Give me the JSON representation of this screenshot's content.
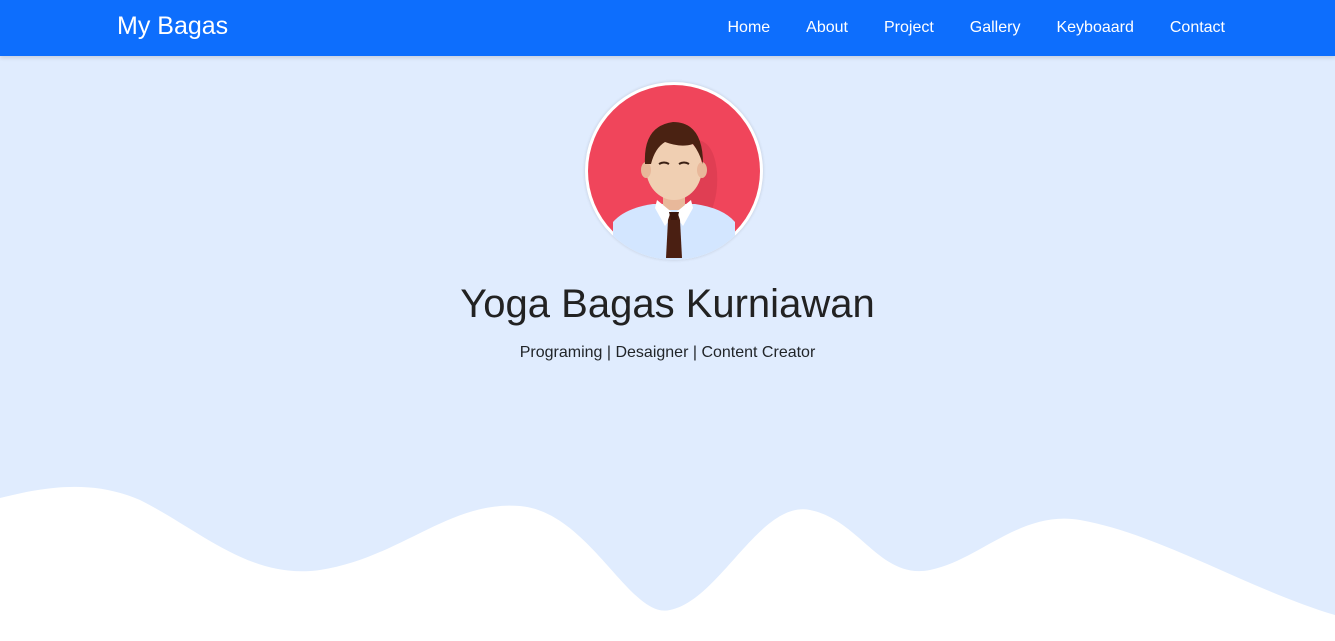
{
  "navbar": {
    "brand": "My Bagas",
    "links": [
      {
        "label": "Home"
      },
      {
        "label": "About"
      },
      {
        "label": "Project"
      },
      {
        "label": "Gallery"
      },
      {
        "label": "Keyboaard"
      },
      {
        "label": "Contact"
      }
    ]
  },
  "hero": {
    "avatar_alt": "profile avatar",
    "name": "Yoga Bagas Kurniawan",
    "tagline": "Programing | Desaigner | Content Creator"
  },
  "colors": {
    "navbar_bg": "#0d6efd",
    "hero_bg": "#e0ecfe",
    "wave": "#ffffff",
    "avatar_bg": "#f0455b"
  }
}
